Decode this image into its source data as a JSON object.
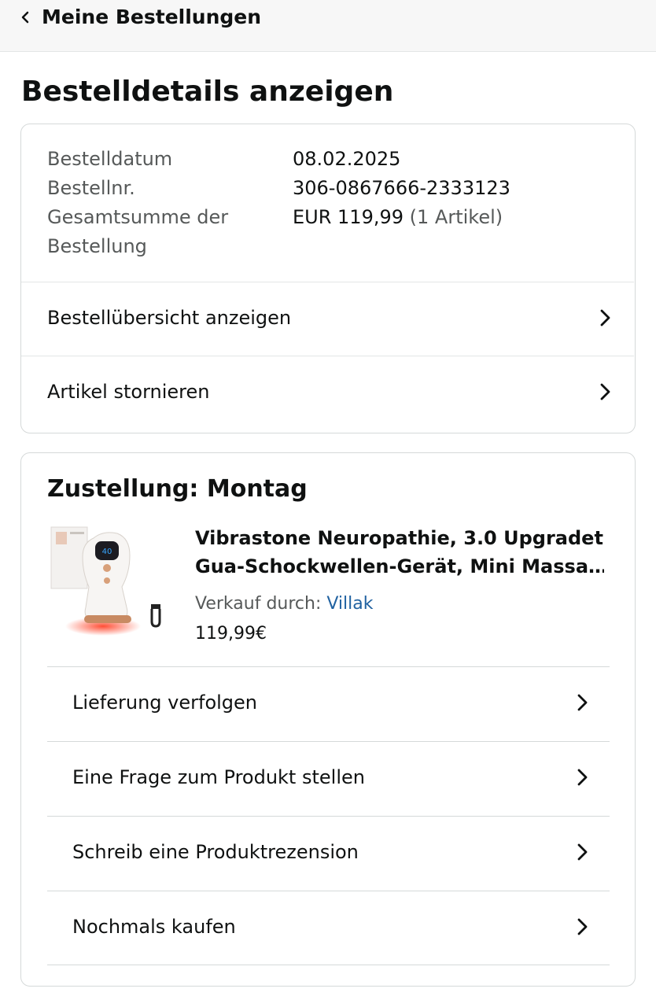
{
  "header": {
    "back_label": "Meine Bestellungen"
  },
  "page": {
    "title": "Bestelldetails anzeigen"
  },
  "order_summary": {
    "date_label": "Bestelldatum",
    "date_value": "08.02.2025",
    "number_label": "Bestellnr.",
    "number_value": "306-0867666-2333123",
    "total_label_line1": "Gesamtsumme der",
    "total_label_line2": "Bestellung",
    "total_value": "EUR 119,99",
    "total_items": "(1 Artikel)",
    "rows": [
      {
        "label": "Bestellübersicht anzeigen"
      },
      {
        "label": "Artikel stornieren"
      }
    ]
  },
  "delivery": {
    "title": "Zustellung: Montag",
    "product": {
      "title_line1": "Vibrastone Neuropathie, 3.0 Upgradet",
      "title_line2": "Gua-Schockwellen-Gerät, Mini Massa…",
      "seller_prefix": "Verkauf durch:",
      "seller_name": "Villak",
      "price": "119,99€",
      "image_display": "40"
    },
    "actions": [
      {
        "label": "Lieferung verfolgen"
      },
      {
        "label": "Eine Frage zum Produkt stellen"
      },
      {
        "label": "Schreib eine Produktrezension"
      },
      {
        "label": "Nochmals kaufen"
      }
    ]
  },
  "colors": {
    "link": "#2162a1",
    "muted_text": "#565959",
    "border": "#d5d9d9",
    "topbar_bg": "#f7f7f7"
  },
  "icons": {
    "back": "chevron-left-icon",
    "row": "chevron-right-icon"
  }
}
